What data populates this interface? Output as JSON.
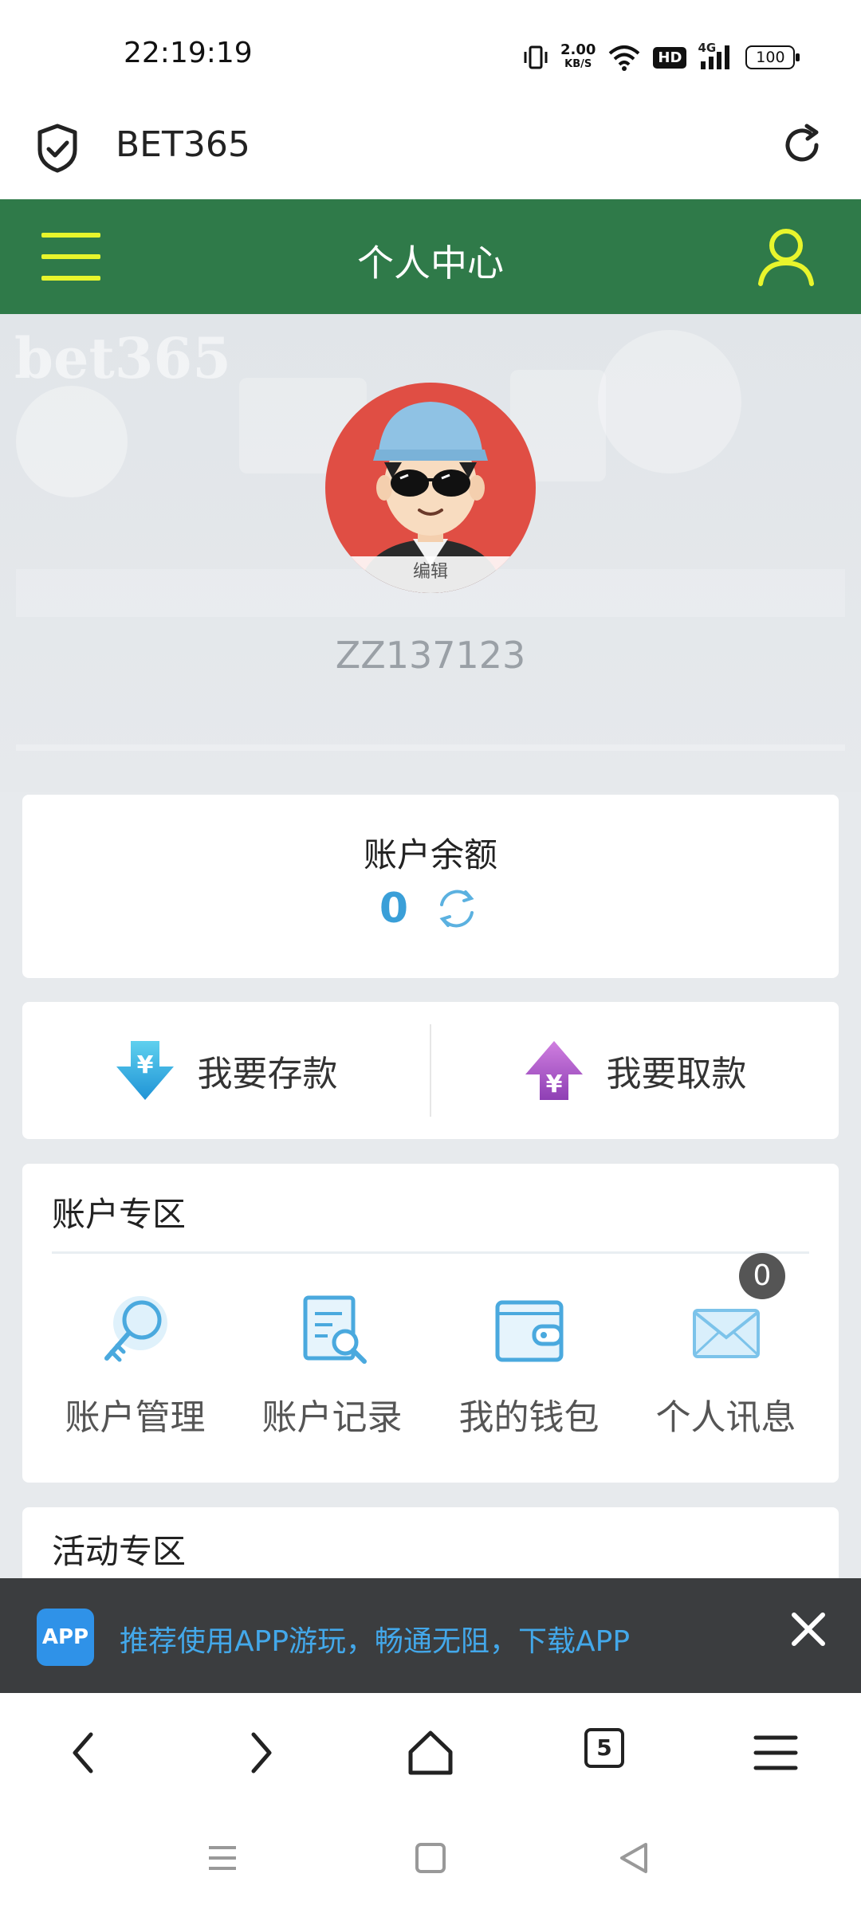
{
  "status_bar": {
    "time": "22:19:19",
    "net_speed_value": "2.00",
    "net_speed_unit": "KB/S",
    "hd_label": "HD",
    "signal_label": "4G",
    "battery": "100"
  },
  "browser": {
    "site_title": "BET365",
    "tab_count": "5"
  },
  "header": {
    "title": "个人中心"
  },
  "profile": {
    "edit_label": "编辑",
    "username": "ZZ137123"
  },
  "balance": {
    "label": "账户余额",
    "value": "0"
  },
  "actions": {
    "deposit_label": "我要存款",
    "withdraw_label": "我要取款"
  },
  "account_zone": {
    "title": "账户专区",
    "items": [
      {
        "label": "账户管理",
        "icon": "key-search-icon"
      },
      {
        "label": "账户记录",
        "icon": "record-search-icon"
      },
      {
        "label": "我的钱包",
        "icon": "wallet-icon"
      },
      {
        "label": "个人讯息",
        "icon": "mail-icon",
        "badge": "0"
      }
    ]
  },
  "activity_zone": {
    "title": "活动专区"
  },
  "promo": {
    "app_label": "APP",
    "text": "推荐使用APP游玩，畅通无阻，下载APP"
  },
  "colors": {
    "header_green": "#2f7a49",
    "accent_yellow": "#e8f52c",
    "balance_blue": "#3a9fd8",
    "promo_blue": "#43a8ea"
  }
}
